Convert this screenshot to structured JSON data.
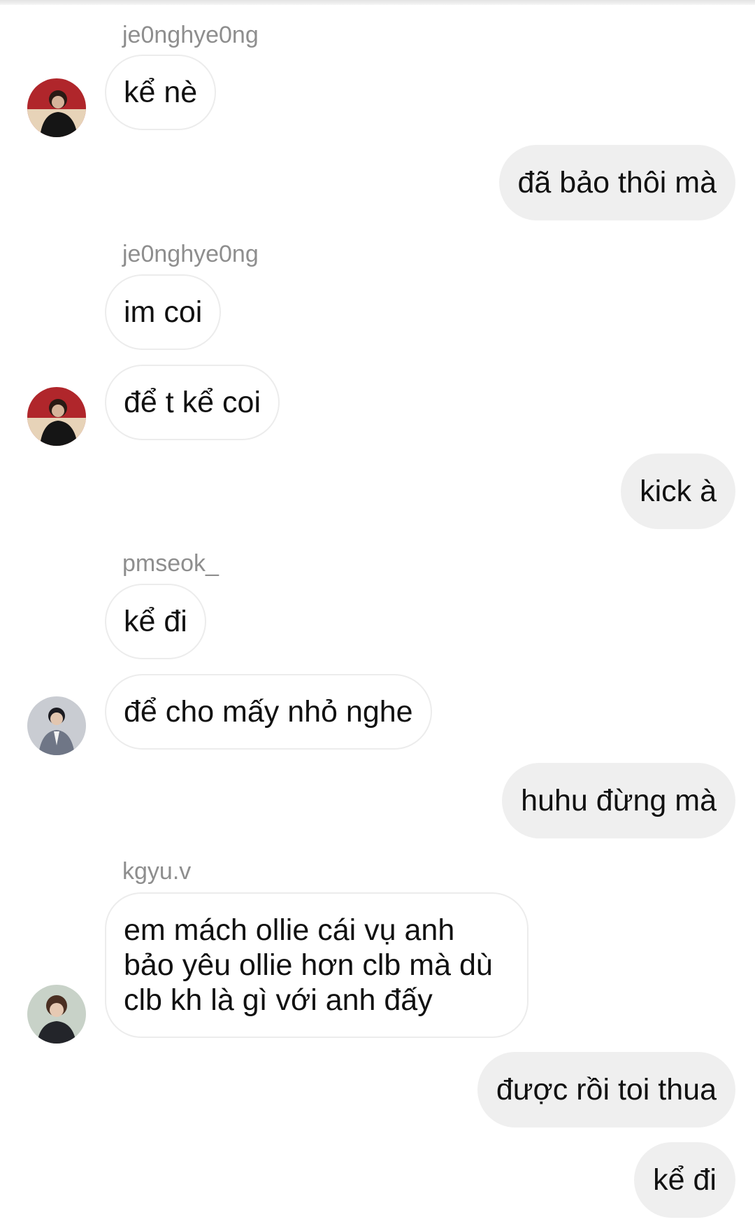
{
  "messages": [
    {
      "sender": "je0nghye0ng"
    },
    {
      "text": "kể nè"
    },
    {
      "text": "đã bảo thôi mà"
    },
    {
      "sender": "je0nghye0ng"
    },
    {
      "text": "im coi"
    },
    {
      "text": "để t kể coi"
    },
    {
      "text": "kick à"
    },
    {
      "sender": "pmseok_"
    },
    {
      "text": "kể đi"
    },
    {
      "text": "để cho mấy nhỏ nghe"
    },
    {
      "text": "huhu đừng mà"
    },
    {
      "sender": "kgyu.v"
    },
    {
      "text": "em mách ollie cái vụ anh bảo yêu ollie hơn clb mà dù clb kh là gì với anh đấy"
    },
    {
      "text": "được rồi toi thua"
    },
    {
      "text": "kể đi"
    }
  ],
  "colors": {
    "incoming_bubble": "#ffffff",
    "incoming_border": "#ececec",
    "outgoing_bubble": "#efefef",
    "sender_name": "#8e8e8e"
  }
}
